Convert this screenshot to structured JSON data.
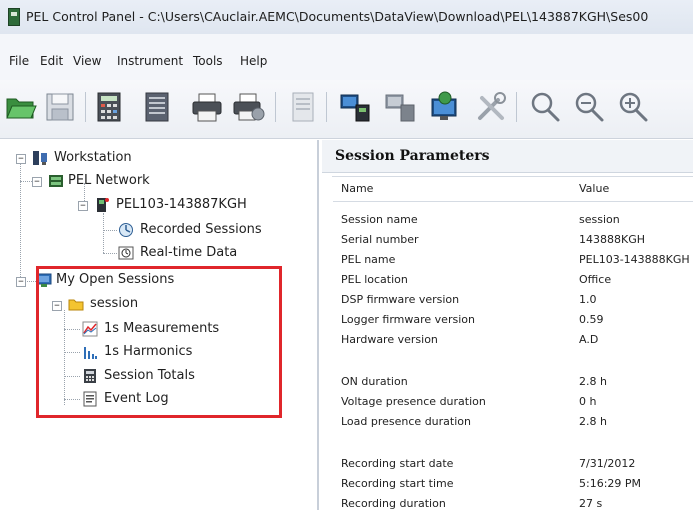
{
  "window": {
    "title": "PEL Control Panel - C:\\Users\\CAuclair.AEMC\\Documents\\DataView\\Download\\PEL\\143887KGH\\Ses00"
  },
  "menu": {
    "items": [
      "File",
      "Edit",
      "View",
      "Instrument",
      "Tools",
      "Help"
    ]
  },
  "toolbar": {
    "icons": [
      "open-folder-icon",
      "save-icon",
      "calculator-icon",
      "print-icon",
      "print-setup-icon",
      "report-icon",
      "connect-instrument-icon",
      "disconnect-instrument-icon",
      "instrument-status-icon",
      "tools-icon",
      "zoom-icon",
      "zoom-out-icon",
      "zoom-in-icon"
    ]
  },
  "tree": {
    "workstation": "Workstation",
    "pel_network": "PEL Network",
    "device": "PEL103-143887KGH",
    "recorded_sessions": "Recorded Sessions",
    "realtime_data": "Real-time Data",
    "my_open_sessions": "My Open Sessions",
    "session": "session",
    "measurements": "1s Measurements",
    "harmonics": "1s Harmonics",
    "session_totals": "Session Totals",
    "event_log": "Event Log"
  },
  "params": {
    "title": "Session Parameters",
    "col_name": "Name",
    "col_value": "Value",
    "rows": [
      {
        "name": "Session name",
        "value": "session"
      },
      {
        "name": "Serial number",
        "value": "143888KGH"
      },
      {
        "name": "PEL name",
        "value": "PEL103-143888KGH"
      },
      {
        "name": "PEL location",
        "value": "Office"
      },
      {
        "name": "DSP firmware version",
        "value": "1.0"
      },
      {
        "name": "Logger firmware version",
        "value": "0.59"
      },
      {
        "name": "Hardware version",
        "value": "A.D"
      },
      {
        "name": "",
        "value": ""
      },
      {
        "name": "ON duration",
        "value": "2.8 h"
      },
      {
        "name": "Voltage presence duration",
        "value": "0 h"
      },
      {
        "name": "Load presence duration",
        "value": "2.8 h"
      },
      {
        "name": "",
        "value": ""
      },
      {
        "name": "Recording start date",
        "value": "7/31/2012"
      },
      {
        "name": "Recording start time",
        "value": "5:16:29 PM"
      },
      {
        "name": "Recording duration",
        "value": "27 s"
      }
    ]
  },
  "colors": {
    "highlight": "#e0262b"
  }
}
